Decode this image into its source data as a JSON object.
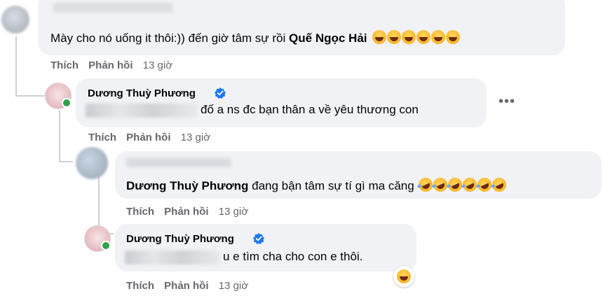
{
  "comment1": {
    "text_prefix": "Mày cho nó uống it thôi:)) đến giờ tâm sự rồi",
    "mention": "Quế Ngọc Hải",
    "actions": {
      "like": "Thích",
      "reply": "Phản hồi",
      "time": "13 giờ"
    }
  },
  "reply1": {
    "author": "Dương Thuỳ Phương",
    "text_visible": "đố a ns đc bạn thân a về yêu thương con",
    "actions": {
      "like": "Thích",
      "reply": "Phản hồi",
      "time": "13 giờ"
    },
    "more_icon": "more-horizontal-icon"
  },
  "reply2": {
    "mention": "Dương Thuỳ Phương",
    "text": "đang bận tâm sự tí gì ma căng",
    "actions": {
      "like": "Thích",
      "reply": "Phản hồi",
      "time": "13 giờ"
    }
  },
  "reply3": {
    "author": "Dương Thuỳ Phương",
    "text_visible": "u e tìm cha cho con e thôi.",
    "actions": {
      "like": "Thích",
      "reply": "Phản hồi",
      "time": "13 giờ"
    }
  },
  "colors": {
    "bubble_bg": "#f0f2f5",
    "meta_gray": "#65676b",
    "verified_blue": "#1877f2",
    "online_green": "#31a24c"
  },
  "icons": [
    "verified-badge-icon",
    "laughing-squint-emoji",
    "rofl-emoji",
    "grinning-emoji",
    "more-horizontal-icon"
  ]
}
